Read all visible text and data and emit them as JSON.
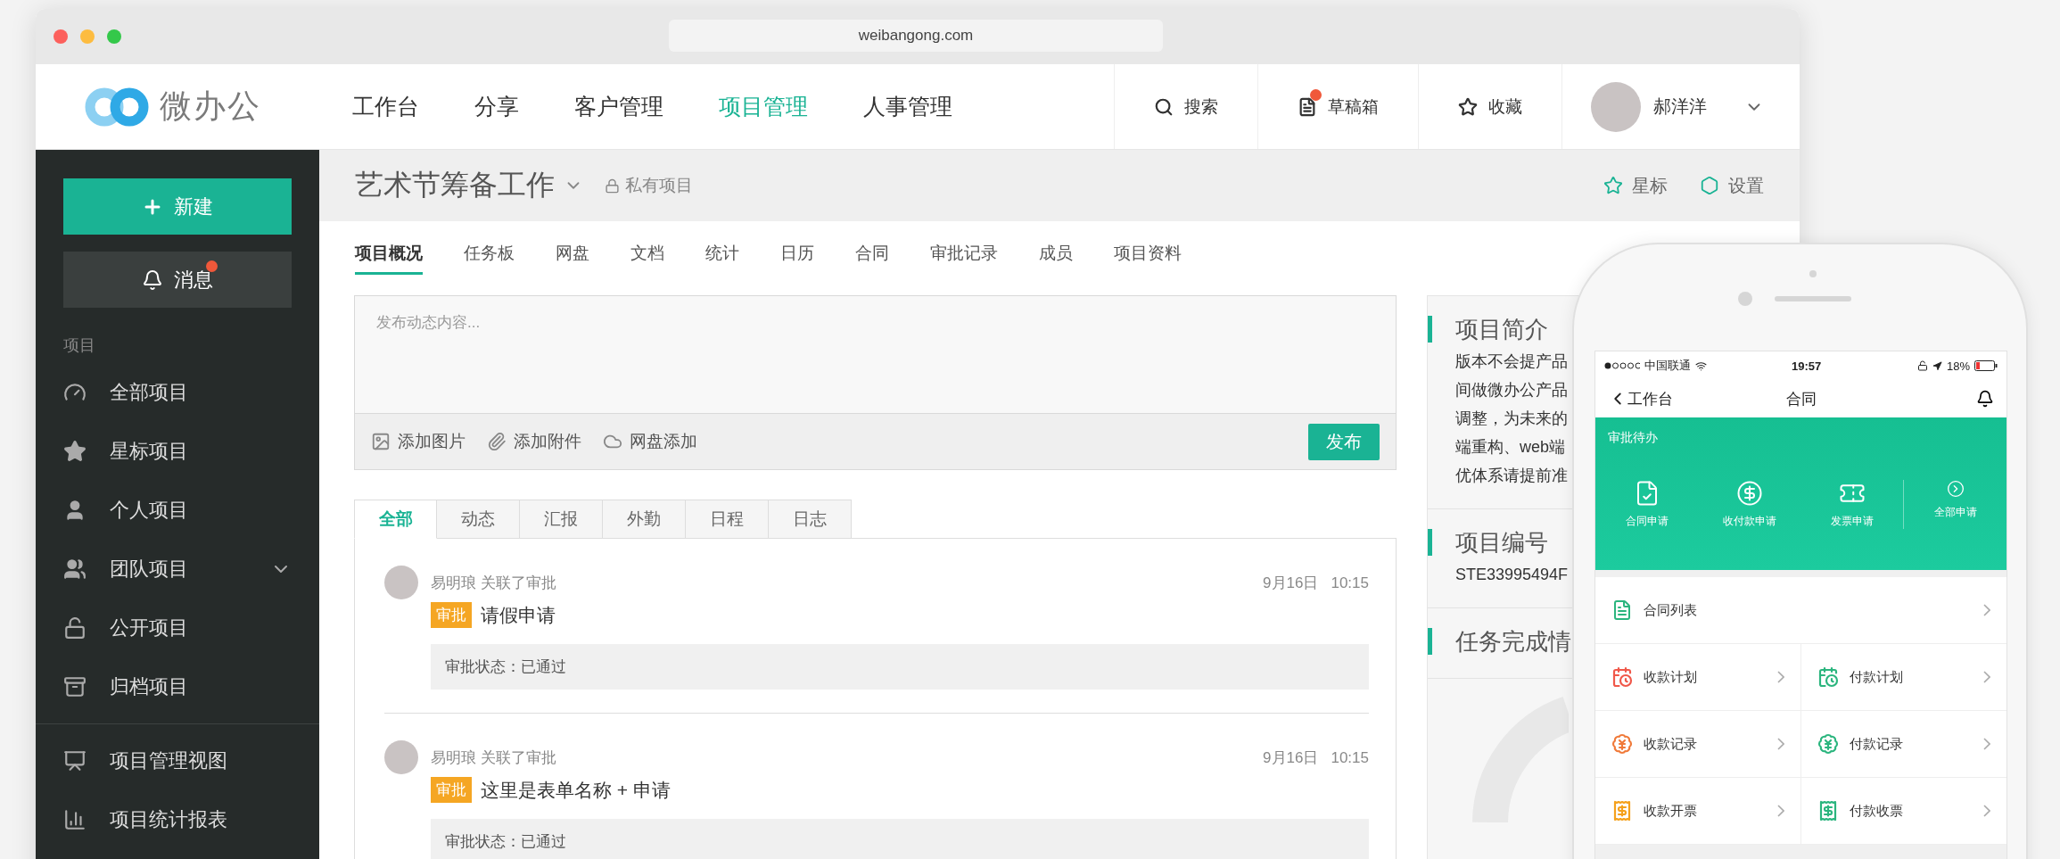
{
  "browser": {
    "address": "weibangong.com"
  },
  "app": {
    "logo_text": "微办公",
    "nav": [
      {
        "label": "工作台",
        "selected": false
      },
      {
        "label": "分享",
        "selected": false
      },
      {
        "label": "客户管理",
        "selected": false
      },
      {
        "label": "项目管理",
        "selected": true
      },
      {
        "label": "人事管理",
        "selected": false
      }
    ],
    "actions": [
      {
        "label": "搜索",
        "notification": false
      },
      {
        "label": "草稿箱",
        "notification": true
      },
      {
        "label": "收藏",
        "notification": false
      }
    ],
    "user": {
      "name": "郝洋洋"
    }
  },
  "sidebar": {
    "new_button": "新建",
    "messages": {
      "label": "消息",
      "notification": true
    },
    "section_label": "项目",
    "items": [
      {
        "label": "全部项目",
        "expandable": false
      },
      {
        "label": "星标项目",
        "expandable": false
      },
      {
        "label": "个人项目",
        "expandable": false
      },
      {
        "label": "团队项目",
        "expandable": true
      },
      {
        "label": "公开项目",
        "expandable": false
      },
      {
        "label": "归档项目",
        "expandable": false
      }
    ],
    "tools": [
      {
        "label": "项目管理视图"
      },
      {
        "label": "项目统计报表"
      }
    ]
  },
  "project": {
    "title": "艺术节筹备工作",
    "privacy": "私有项目",
    "actions": [
      "星标",
      "设置"
    ],
    "tabs": [
      {
        "label": "项目概况",
        "selected": true
      },
      {
        "label": "任务板",
        "selected": false
      },
      {
        "label": "网盘",
        "selected": false
      },
      {
        "label": "文档",
        "selected": false
      },
      {
        "label": "统计",
        "selected": false
      },
      {
        "label": "日历",
        "selected": false
      },
      {
        "label": "合同",
        "selected": false
      },
      {
        "label": "审批记录",
        "selected": false
      },
      {
        "label": "成员",
        "selected": false
      },
      {
        "label": "项目资料",
        "selected": false
      }
    ]
  },
  "composer": {
    "placeholder": "发布动态内容...",
    "tools": [
      "添加图片",
      "添加附件",
      "网盘添加"
    ],
    "submit": "发布"
  },
  "feed": {
    "filters": [
      {
        "label": "全部",
        "selected": true
      },
      {
        "label": "动态",
        "selected": false
      },
      {
        "label": "汇报",
        "selected": false
      },
      {
        "label": "外勤",
        "selected": false
      },
      {
        "label": "日程",
        "selected": false
      },
      {
        "label": "日志",
        "selected": false
      }
    ],
    "items": [
      {
        "author": "易明琅 关联了审批",
        "date": "9月16日",
        "time": "10:15",
        "tag": "审批",
        "title": "请假申请",
        "status": "审批状态：已通过"
      },
      {
        "author": "易明琅 关联了审批",
        "date": "9月16日",
        "time": "10:15",
        "tag": "审批",
        "title": "这里是表单名称 + 申请",
        "status": "审批状态：已通过"
      }
    ]
  },
  "info_panel": {
    "sections": [
      {
        "heading": "项目简介",
        "lines": [
          "版本不会提产品",
          "间做微办公产品",
          "调整，为未来的",
          "端重构、web端",
          "优体系请提前准"
        ]
      },
      {
        "heading": "项目编号",
        "lines": [
          "STE33995494F"
        ]
      },
      {
        "heading": "任务完成情"
      }
    ]
  },
  "phone": {
    "status": {
      "carrier": "中国联通",
      "time": "19:57",
      "battery": "18%"
    },
    "nav": {
      "back": "工作台",
      "title": "合同"
    },
    "banner": {
      "title": "审批待办",
      "actions": [
        "合同申请",
        "收付款申请",
        "发票申请",
        "全部申请"
      ]
    },
    "list": [
      {
        "label": "合同列表"
      }
    ],
    "grid": [
      {
        "label": "收款计划",
        "color": "#f0584a"
      },
      {
        "label": "付款计划",
        "color": "#2bb57e"
      },
      {
        "label": "收款记录",
        "color": "#f07a3a"
      },
      {
        "label": "付款记录",
        "color": "#2bb57e"
      },
      {
        "label": "收款开票",
        "color": "#f5a11c"
      },
      {
        "label": "付款收票",
        "color": "#2bb57e"
      }
    ]
  }
}
